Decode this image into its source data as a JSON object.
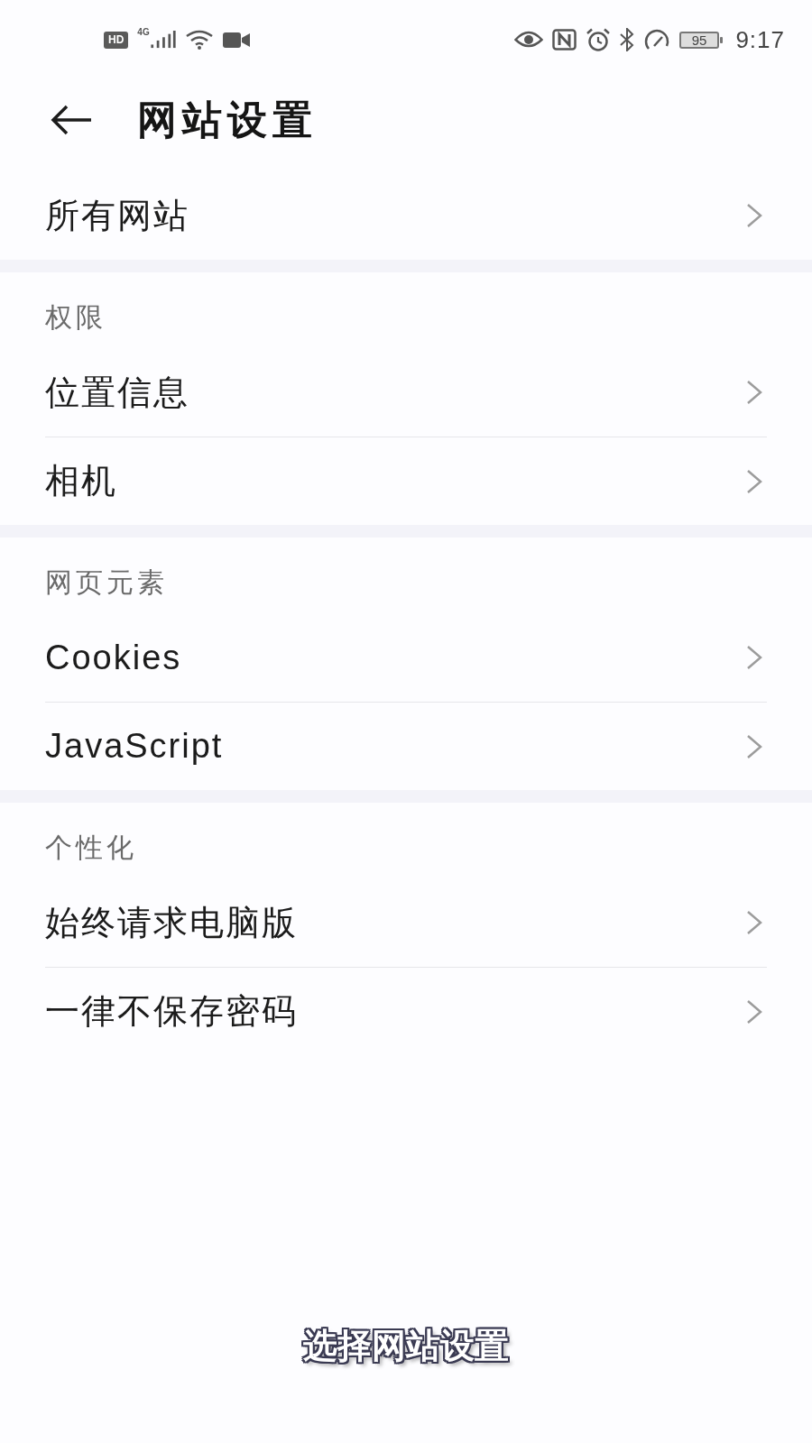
{
  "status_bar": {
    "hd": "HD",
    "network": "4G",
    "battery": "95",
    "time": "9:17"
  },
  "header": {
    "title": "网站设置"
  },
  "sections": [
    {
      "items": [
        {
          "label": "所有网站"
        }
      ]
    },
    {
      "title": "权限",
      "items": [
        {
          "label": "位置信息"
        },
        {
          "label": "相机"
        }
      ]
    },
    {
      "title": "网页元素",
      "items": [
        {
          "label": "Cookies"
        },
        {
          "label": "JavaScript"
        }
      ]
    },
    {
      "title": "个性化",
      "items": [
        {
          "label": "始终请求电脑版"
        },
        {
          "label": "一律不保存密码"
        }
      ]
    }
  ],
  "caption": "选择网站设置"
}
